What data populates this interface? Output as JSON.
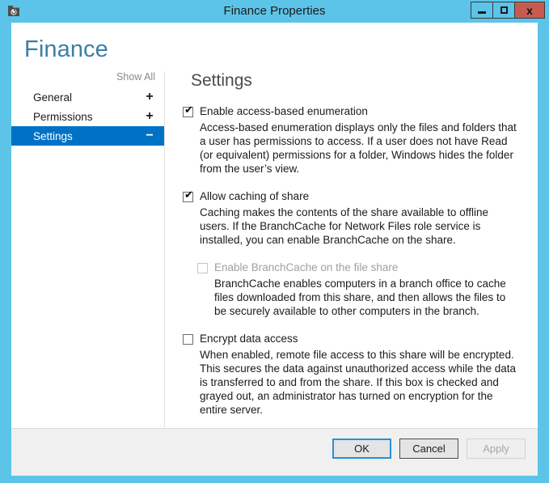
{
  "window": {
    "title": "Finance Properties",
    "icon": "shared-folder-icon",
    "accent_titlebar_color": "#5cc4e8",
    "close_button_color": "#c75b52",
    "controls": {
      "minimize": "minimize-icon",
      "maximize": "maximize-icon",
      "close": "x"
    }
  },
  "page": {
    "heading": "Finance",
    "heading_color": "#3b7ea8"
  },
  "nav": {
    "show_all_label": "Show All",
    "selection_color": "#0072c6",
    "items": [
      {
        "label": "General",
        "sign": "+",
        "selected": false
      },
      {
        "label": "Permissions",
        "sign": "+",
        "selected": false
      },
      {
        "label": "Settings",
        "sign": "−",
        "selected": true
      }
    ]
  },
  "content": {
    "title": "Settings",
    "options": [
      {
        "label": "Enable access-based enumeration",
        "checked": true,
        "disabled": false,
        "description": "Access-based enumeration displays only the files and folders that a user has permissions to access. If a user does not have Read (or equivalent) permissions for a folder, Windows hides the folder from the user’s view."
      },
      {
        "label": "Allow caching of share",
        "checked": true,
        "disabled": false,
        "description": "Caching makes the contents of the share available to offline users. If the BranchCache for Network Files role service is installed, you can enable BranchCache on the share."
      },
      {
        "label": "Enable BranchCache on the file share",
        "checked": false,
        "disabled": true,
        "description": "BranchCache enables computers in a branch office to cache files downloaded from this share, and then allows the files to be securely available to other computers in the branch."
      },
      {
        "label": "Encrypt data access",
        "checked": false,
        "disabled": false,
        "description": "When enabled, remote file access to this share will be encrypted. This secures the data against unauthorized access while the data is transferred to and from the share. If this box is checked and grayed out, an administrator has turned on encryption for the entire server."
      }
    ],
    "checkmark_glyph": "✔"
  },
  "footer": {
    "ok_label": "OK",
    "cancel_label": "Cancel",
    "apply_label": "Apply",
    "apply_disabled": true
  }
}
